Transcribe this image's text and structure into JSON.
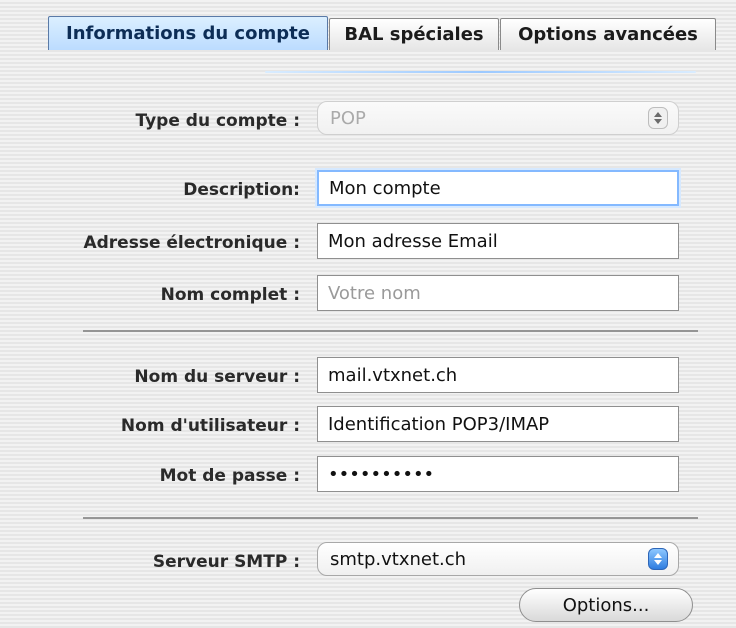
{
  "tabs": [
    {
      "label": "Informations du compte"
    },
    {
      "label": "BAL spéciales"
    },
    {
      "label": "Options avancées"
    }
  ],
  "form": {
    "account_type": {
      "label": "Type du compte :",
      "value": "POP"
    },
    "description": {
      "label": "Description:",
      "value": "Mon compte"
    },
    "email": {
      "label": "Adresse électronique :",
      "value": "Mon adresse Email"
    },
    "full_name": {
      "label": "Nom complet :",
      "placeholder": "Votre nom"
    },
    "server": {
      "label": "Nom du serveur :",
      "value": "mail.vtxnet.ch"
    },
    "username": {
      "label": "Nom d'utilisateur :",
      "value": "Identification POP3/IMAP"
    },
    "password": {
      "label": "Mot de passe :",
      "value": "••••••••••"
    },
    "smtp": {
      "label": "Serveur SMTP :",
      "value": "smtp.vtxnet.ch"
    }
  },
  "buttons": {
    "options": "Options..."
  },
  "icons": {
    "select_arrows": "up-down-arrows-icon"
  },
  "colors": {
    "active_tab_bg_top": "#dbefff",
    "active_tab_bg_bottom": "#bcdcff",
    "focus_ring": "#84b9ff",
    "smtp_arrows": "#2f7de0"
  }
}
